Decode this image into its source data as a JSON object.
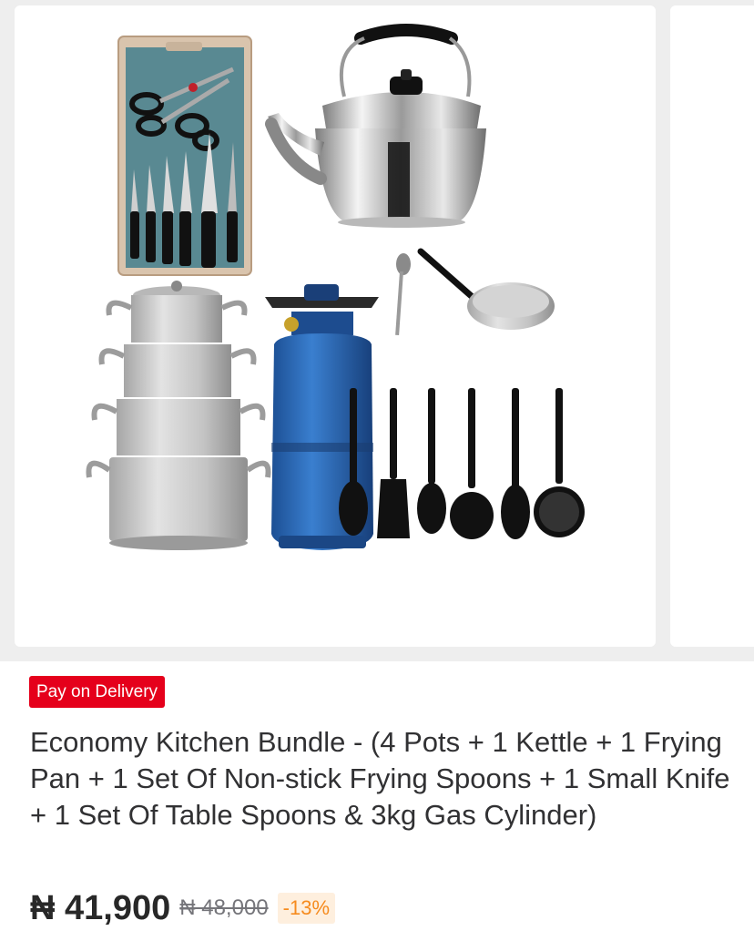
{
  "product": {
    "image_description_icons": [
      "knife-set-icon",
      "kettle-icon",
      "pot-set-icon",
      "gas-cylinder-icon",
      "frying-pan-icon",
      "spoon-set-icon"
    ],
    "badge": "Pay on Delivery",
    "title": "Economy Kitchen Bundle - (4 Pots + 1 Kettle + 1 Frying Pan + 1 Set Of Non-stick Frying Spoons + 1 Small Knife + 1 Set Of Table Spoons & 3kg Gas Cylinder)",
    "price": "₦ 41,900",
    "old_price": "₦ 48,000",
    "discount": "-13%"
  },
  "colors": {
    "badge_bg": "#e5001b",
    "discount_text": "#f68b1e",
    "discount_bg": "#feefde",
    "cylinder": "#2a68b6"
  }
}
